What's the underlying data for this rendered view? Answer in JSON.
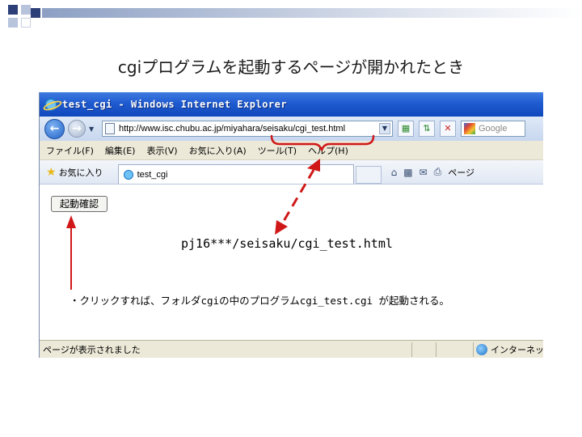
{
  "slide": {
    "title": "cgiプログラムを起動するページが開かれたとき"
  },
  "browser": {
    "window_title": "test_cgi - Windows Internet Explorer",
    "address_url": "http://www.isc.chubu.ac.jp/miyahara/seisaku/cgi_test.html",
    "search_placeholder": "Google",
    "menu": [
      "ファイル(F)",
      "編集(E)",
      "表示(V)",
      "お気に入り(A)",
      "ツール(T)",
      "ヘルプ(H)"
    ],
    "favorites_label": "お気に入り",
    "tab_label": "test_cgi",
    "page_menu_label": "ページ",
    "status_text": "ページが表示されました",
    "zone_text": "インターネット"
  },
  "content": {
    "launch_button_label": "起動確認"
  },
  "annotations": {
    "server_path": "pj16***/seisaku/cgi_test.html",
    "note": "・クリックすれば、フォルダcgiの中のプログラムcgi_test.cgi が起動される。"
  },
  "colors": {
    "annotation_red": "#d01818",
    "titlebar_blue": "#1f5bd0"
  }
}
